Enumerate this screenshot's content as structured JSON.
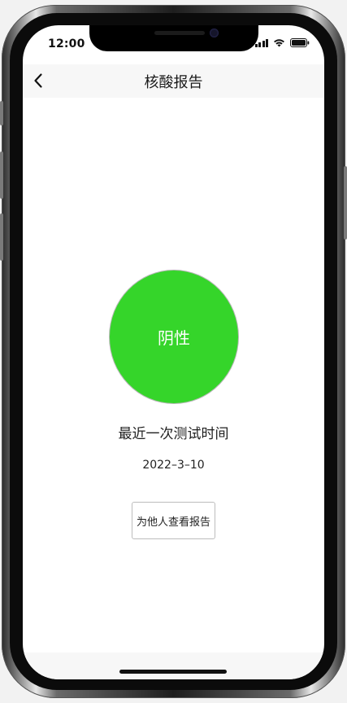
{
  "status_bar": {
    "time": "12:00",
    "icons": [
      "signal-icon",
      "wifi-icon",
      "battery-icon"
    ]
  },
  "nav": {
    "title": "核酸报告",
    "back_icon": "chevron-left-icon"
  },
  "result": {
    "status": "阴性",
    "color": "#35d52a"
  },
  "last_test": {
    "label": "最近一次测试时间",
    "date": "2022–3–10"
  },
  "actions": {
    "view_for_others": "为他人查看报告"
  }
}
